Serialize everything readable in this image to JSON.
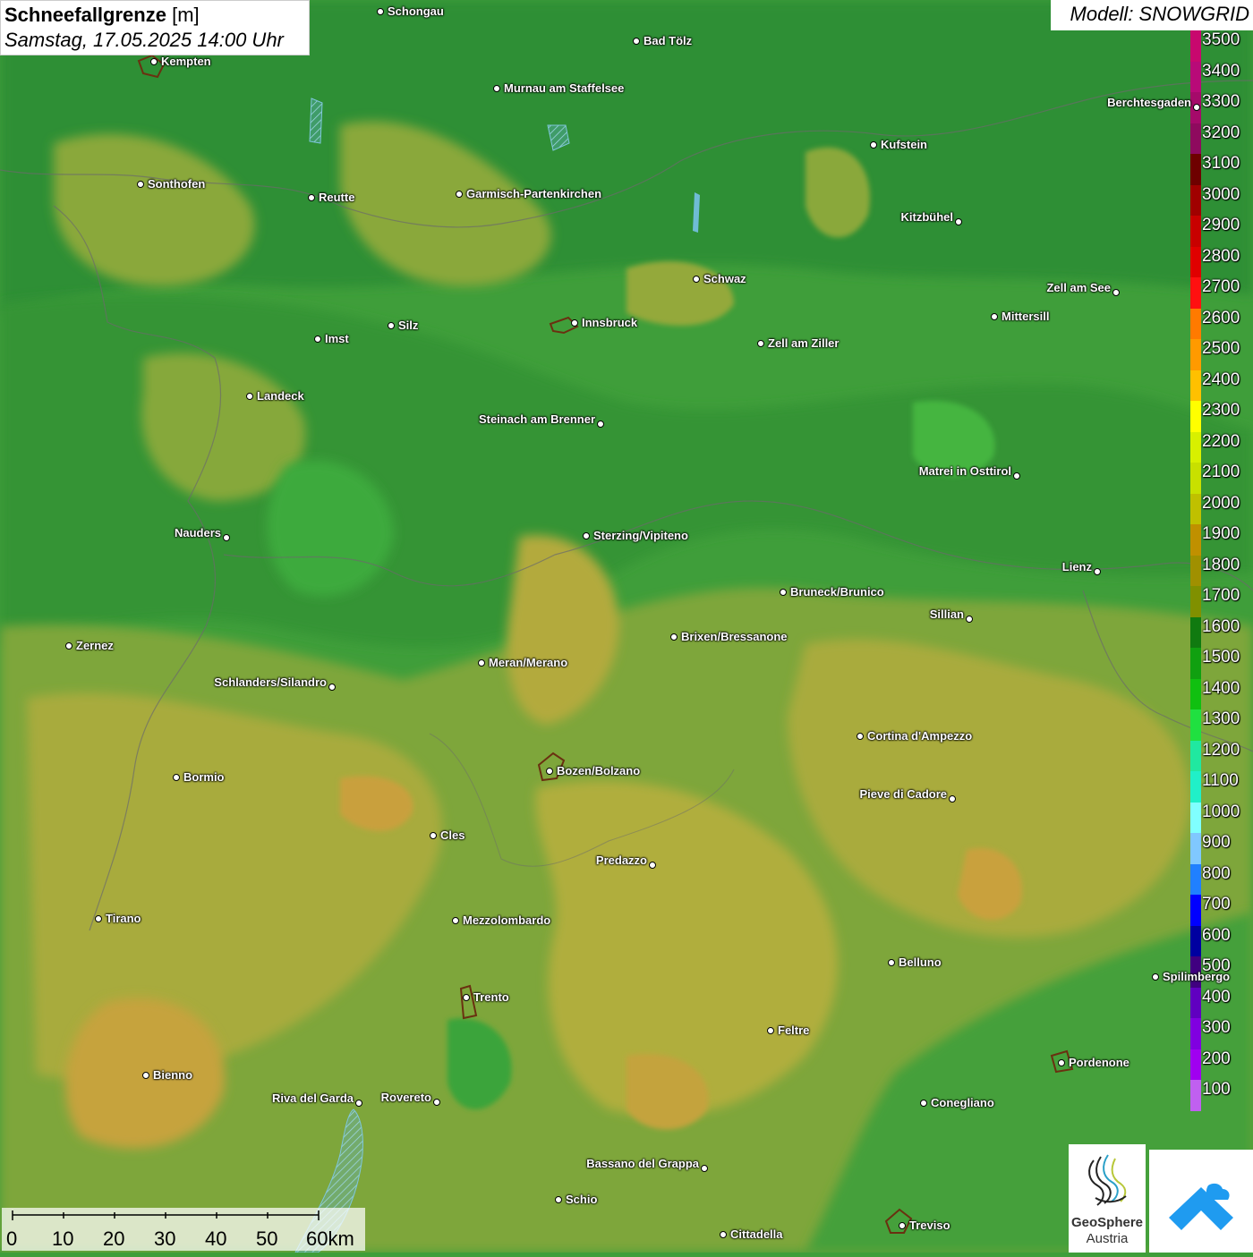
{
  "header": {
    "title_bold": "Schneefallgrenze",
    "title_unit": "[m]",
    "subtitle": "Samstag, 17.05.2025 14:00 Uhr",
    "model": "Modell: SNOWGRID"
  },
  "legend": {
    "labels": [
      "3500",
      "3400",
      "3300",
      "3200",
      "3100",
      "3000",
      "2900",
      "2800",
      "2700",
      "2600",
      "2500",
      "2400",
      "2300",
      "2200",
      "2100",
      "2000",
      "1900",
      "1800",
      "1700",
      "1600",
      "1500",
      "1400",
      "1300",
      "1200",
      "1100",
      "1000",
      "900",
      "800",
      "700",
      "600",
      "500",
      "400",
      "300",
      "200",
      "100"
    ],
    "colors": [
      "#c8086e",
      "#b80a78",
      "#a50a6a",
      "#8e0a5e",
      "#6e0000",
      "#a00000",
      "#c80000",
      "#e00000",
      "#ff1010",
      "#ff7a00",
      "#ff9a00",
      "#ffc000",
      "#ffff00",
      "#d8f000",
      "#c8e000",
      "#c0c000",
      "#c09000",
      "#a09000",
      "#809000",
      "#107a10",
      "#10a010",
      "#10c010",
      "#20e040",
      "#20e8a0",
      "#20f0c8",
      "#80ffff",
      "#80c8ff",
      "#2080ff",
      "#0000ff",
      "#0000a0",
      "#400080",
      "#6000c0",
      "#8000e0",
      "#a000f0",
      "#c060f0"
    ]
  },
  "cities": [
    {
      "name": "Schongau",
      "label_side": "right"
    },
    {
      "name": "Bad Tölz",
      "label_side": "right"
    },
    {
      "name": "Kempten",
      "label_side": "right"
    },
    {
      "name": "Murnau am Staffelsee",
      "label_side": "right"
    },
    {
      "name": "Berchtesgaden",
      "label_side": "left"
    },
    {
      "name": "Kufstein",
      "label_side": "right"
    },
    {
      "name": "Sonthofen",
      "label_side": "right"
    },
    {
      "name": "Reutte",
      "label_side": "right"
    },
    {
      "name": "Garmisch-Partenkirchen",
      "label_side": "right"
    },
    {
      "name": "Kitzbühel",
      "label_side": "left"
    },
    {
      "name": "Schwaz",
      "label_side": "right"
    },
    {
      "name": "Zell am See",
      "label_side": "left"
    },
    {
      "name": "Innsbruck",
      "label_side": "right"
    },
    {
      "name": "Mittersill",
      "label_side": "right"
    },
    {
      "name": "Silz",
      "label_side": "right"
    },
    {
      "name": "Imst",
      "label_side": "right"
    },
    {
      "name": "Zell am Ziller",
      "label_side": "right"
    },
    {
      "name": "Landeck",
      "label_side": "right"
    },
    {
      "name": "Steinach am Brenner",
      "label_side": "left"
    },
    {
      "name": "Matrei in Osttirol",
      "label_side": "left"
    },
    {
      "name": "Nauders",
      "label_side": "left"
    },
    {
      "name": "Sterzing/Vipiteno",
      "label_side": "right"
    },
    {
      "name": "Lienz",
      "label_side": "left"
    },
    {
      "name": "Bruneck/Brunico",
      "label_side": "right"
    },
    {
      "name": "Sillian",
      "label_side": "left"
    },
    {
      "name": "Brixen/Bressanone",
      "label_side": "right"
    },
    {
      "name": "Zernez",
      "label_side": "right"
    },
    {
      "name": "Meran/Merano",
      "label_side": "right"
    },
    {
      "name": "Schlanders/Silandro",
      "label_side": "left"
    },
    {
      "name": "Cortina d'Ampezzo",
      "label_side": "right"
    },
    {
      "name": "Bozen/Bolzano",
      "label_side": "right"
    },
    {
      "name": "Bormio",
      "label_side": "right"
    },
    {
      "name": "Pieve di Cadore",
      "label_side": "left"
    },
    {
      "name": "Cles",
      "label_side": "right"
    },
    {
      "name": "Predazzo",
      "label_side": "left"
    },
    {
      "name": "Tirano",
      "label_side": "right"
    },
    {
      "name": "Mezzolombardo",
      "label_side": "right"
    },
    {
      "name": "Belluno",
      "label_side": "right"
    },
    {
      "name": "Spilimbergo",
      "label_side": "right"
    },
    {
      "name": "Trento",
      "label_side": "right"
    },
    {
      "name": "Feltre",
      "label_side": "right"
    },
    {
      "name": "Pordenone",
      "label_side": "right"
    },
    {
      "name": "Bienno",
      "label_side": "right"
    },
    {
      "name": "Riva del Garda",
      "label_side": "left"
    },
    {
      "name": "Rovereto",
      "label_side": "left"
    },
    {
      "name": "Conegliano",
      "label_side": "right"
    },
    {
      "name": "Bassano del Grappa",
      "label_side": "left"
    },
    {
      "name": "Schio",
      "label_side": "right"
    },
    {
      "name": "Treviso",
      "label_side": "right"
    },
    {
      "name": "Cittadella",
      "label_side": "right"
    }
  ],
  "scale_bar": {
    "labels": [
      "0",
      "10",
      "20",
      "30",
      "40",
      "50",
      "60km"
    ]
  },
  "logo": {
    "line1": "GeoSphere",
    "line2": "Austria"
  },
  "colors": {
    "band_dark_green": "#2f8f34",
    "band_green": "#4aa63c",
    "band_olive": "#8aa83a",
    "band_yellow_olive": "#b0ae3c",
    "band_orange": "#c4a43c",
    "accent_blue": "#1f9bf0"
  }
}
